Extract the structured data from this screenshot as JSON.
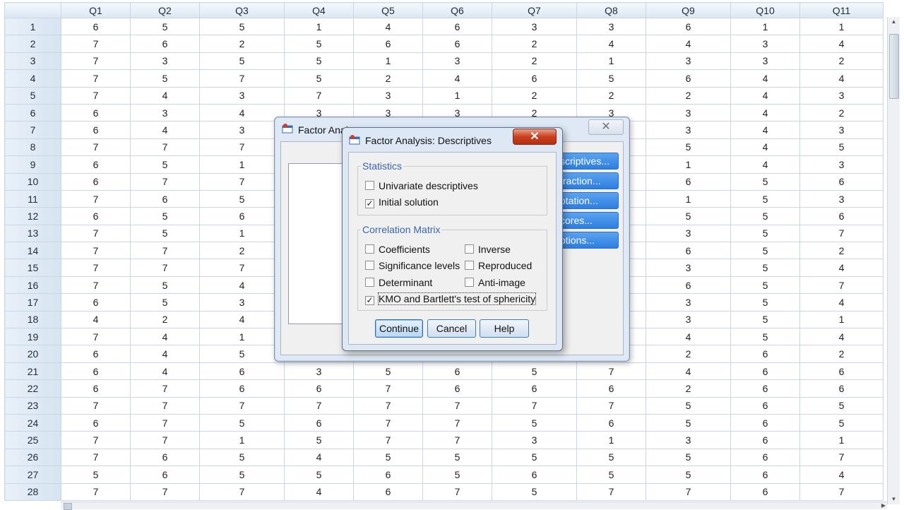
{
  "grid": {
    "columns": [
      "Q1",
      "Q2",
      "Q3",
      "Q4",
      "Q5",
      "Q6",
      "Q7",
      "Q8",
      "Q9",
      "Q10",
      "Q11"
    ],
    "rows": [
      {
        "id": "1",
        "cells": [
          "6",
          "5",
          "5",
          "1",
          "4",
          "6",
          "3",
          "3",
          "6",
          "1",
          "1"
        ]
      },
      {
        "id": "2",
        "cells": [
          "7",
          "6",
          "2",
          "5",
          "6",
          "6",
          "2",
          "4",
          "4",
          "3",
          "4"
        ]
      },
      {
        "id": "3",
        "cells": [
          "7",
          "3",
          "5",
          "5",
          "1",
          "3",
          "2",
          "1",
          "3",
          "3",
          "2"
        ]
      },
      {
        "id": "4",
        "cells": [
          "7",
          "5",
          "7",
          "5",
          "2",
          "4",
          "6",
          "5",
          "6",
          "4",
          "4"
        ]
      },
      {
        "id": "5",
        "cells": [
          "7",
          "4",
          "3",
          "7",
          "3",
          "1",
          "2",
          "2",
          "2",
          "4",
          "3"
        ]
      },
      {
        "id": "6",
        "cells": [
          "6",
          "3",
          "4",
          "3",
          "3",
          "3",
          "2",
          "3",
          "3",
          "4",
          "2"
        ]
      },
      {
        "id": "7",
        "cells": [
          "6",
          "4",
          "3",
          "",
          "",
          "",
          "",
          "",
          "3",
          "4",
          "3"
        ]
      },
      {
        "id": "8",
        "cells": [
          "7",
          "7",
          "7",
          "",
          "",
          "",
          "",
          "",
          "5",
          "4",
          "5"
        ]
      },
      {
        "id": "9",
        "cells": [
          "6",
          "5",
          "1",
          "",
          "",
          "",
          "",
          "",
          "1",
          "4",
          "3"
        ]
      },
      {
        "id": "10",
        "cells": [
          "6",
          "7",
          "7",
          "",
          "",
          "",
          "",
          "",
          "6",
          "5",
          "6"
        ]
      },
      {
        "id": "11",
        "cells": [
          "7",
          "6",
          "5",
          "",
          "",
          "",
          "",
          "",
          "1",
          "5",
          "3"
        ]
      },
      {
        "id": "12",
        "cells": [
          "6",
          "5",
          "6",
          "",
          "",
          "",
          "",
          "",
          "5",
          "5",
          "6"
        ]
      },
      {
        "id": "13",
        "cells": [
          "7",
          "5",
          "1",
          "",
          "",
          "",
          "",
          "",
          "3",
          "5",
          "7"
        ]
      },
      {
        "id": "14",
        "cells": [
          "7",
          "7",
          "2",
          "",
          "",
          "",
          "",
          "",
          "6",
          "5",
          "2"
        ]
      },
      {
        "id": "15",
        "cells": [
          "7",
          "7",
          "7",
          "",
          "",
          "",
          "",
          "",
          "3",
          "5",
          "4"
        ]
      },
      {
        "id": "16",
        "cells": [
          "7",
          "5",
          "4",
          "",
          "",
          "",
          "",
          "",
          "6",
          "5",
          "7"
        ]
      },
      {
        "id": "17",
        "cells": [
          "6",
          "5",
          "3",
          "",
          "",
          "",
          "",
          "",
          "3",
          "5",
          "4"
        ]
      },
      {
        "id": "18",
        "cells": [
          "4",
          "2",
          "4",
          "",
          "",
          "",
          "",
          "",
          "3",
          "5",
          "1"
        ]
      },
      {
        "id": "19",
        "cells": [
          "7",
          "4",
          "1",
          "",
          "",
          "",
          "",
          "",
          "4",
          "5",
          "4"
        ]
      },
      {
        "id": "20",
        "cells": [
          "6",
          "4",
          "5",
          "",
          "",
          "",
          "",
          "",
          "2",
          "6",
          "2"
        ]
      },
      {
        "id": "21",
        "cells": [
          "6",
          "4",
          "6",
          "3",
          "5",
          "6",
          "5",
          "7",
          "4",
          "6",
          "6"
        ]
      },
      {
        "id": "22",
        "cells": [
          "6",
          "7",
          "6",
          "6",
          "7",
          "6",
          "6",
          "6",
          "2",
          "6",
          "6"
        ]
      },
      {
        "id": "23",
        "cells": [
          "7",
          "7",
          "7",
          "7",
          "7",
          "7",
          "7",
          "7",
          "5",
          "6",
          "5"
        ]
      },
      {
        "id": "24",
        "cells": [
          "6",
          "7",
          "5",
          "6",
          "7",
          "7",
          "5",
          "6",
          "5",
          "6",
          "5"
        ]
      },
      {
        "id": "25",
        "cells": [
          "7",
          "7",
          "1",
          "5",
          "7",
          "7",
          "3",
          "1",
          "3",
          "6",
          "1"
        ]
      },
      {
        "id": "26",
        "cells": [
          "7",
          "6",
          "5",
          "4",
          "5",
          "5",
          "5",
          "5",
          "5",
          "6",
          "7"
        ]
      },
      {
        "id": "27",
        "cells": [
          "5",
          "6",
          "5",
          "5",
          "6",
          "5",
          "6",
          "5",
          "5",
          "6",
          "4"
        ]
      },
      {
        "id": "28",
        "cells": [
          "7",
          "7",
          "7",
          "4",
          "6",
          "7",
          "5",
          "7",
          "7",
          "6",
          "7"
        ]
      }
    ]
  },
  "factor_dialog": {
    "title": "Factor Anal",
    "close_glyph": "✕",
    "buttons": [
      "scriptives...",
      "traction...",
      "otation...",
      "cores...",
      "ptions..."
    ]
  },
  "desc_dialog": {
    "title": "Factor Analysis: Descriptives",
    "close_glyph": "✕",
    "statistics": {
      "legend": "Statistics",
      "univariate": {
        "label": "Univariate descriptives",
        "checked": false
      },
      "initial": {
        "label": "Initial solution",
        "checked": true
      }
    },
    "correlation": {
      "legend": "Correlation Matrix",
      "coefficients": {
        "label": "Coefficients",
        "checked": false
      },
      "inverse": {
        "label": "Inverse",
        "checked": false
      },
      "significance": {
        "label": "Significance levels",
        "checked": false
      },
      "reproduced": {
        "label": "Reproduced",
        "checked": false
      },
      "determinant": {
        "label": "Determinant",
        "checked": false
      },
      "anti_image": {
        "label": "Anti-image",
        "checked": false
      },
      "kmo": {
        "label": "KMO and Bartlett's test of sphericity",
        "checked": true
      }
    },
    "buttons": {
      "continue": "Continue",
      "cancel": "Cancel",
      "help": "Help"
    }
  }
}
